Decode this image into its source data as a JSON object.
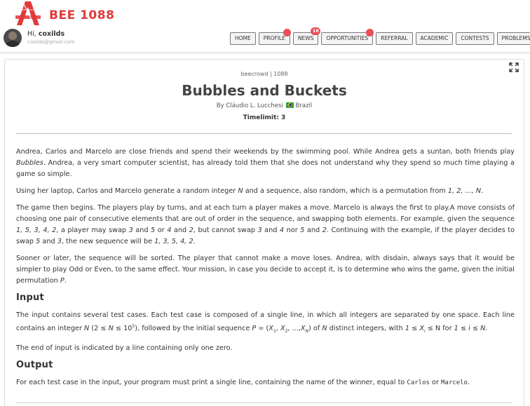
{
  "brand": {
    "name": "BEE 1088",
    "color": "#e03a3a"
  },
  "user": {
    "greeting": "Hi,",
    "name": "coxilds",
    "email": "coxilds@gmail.com"
  },
  "nav": {
    "home": "HOME",
    "profile": "PROFILE",
    "news": "NEWS",
    "news_badge": "18",
    "opportunities": "OPPORTUNITIES",
    "referral": "REFERRAL",
    "academic": "ACADEMIC",
    "contests": "CONTESTS",
    "problems": "PROBLEMS"
  },
  "problem": {
    "crumb": "beecrowd | 1088",
    "title": "Bubbles and Buckets",
    "author_prefix": "By Cláudio L. Lucchesi",
    "country": "Brazil",
    "timelimit": "Timelimit: 3",
    "input_heading": "Input",
    "output_heading": "Output",
    "winner_a": "Carlos",
    "winner_b": "Marcelo"
  }
}
